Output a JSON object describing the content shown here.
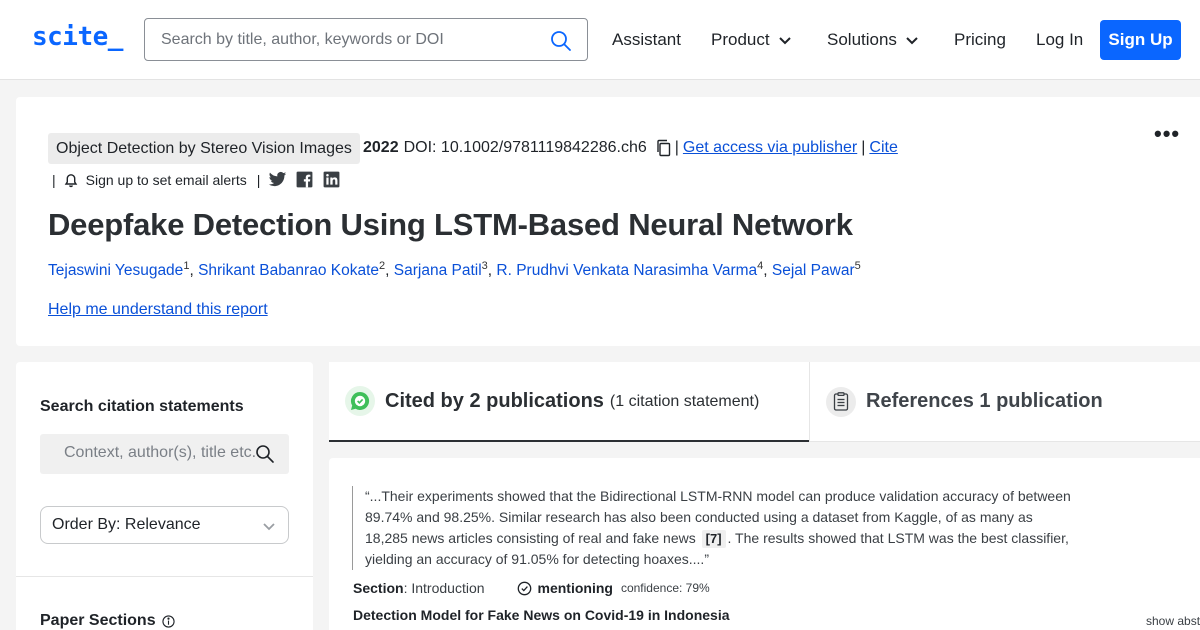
{
  "header": {
    "logo": "scite_",
    "search_placeholder": "Search by title, author, keywords or DOI",
    "nav": {
      "assistant": "Assistant",
      "product": "Product",
      "solutions": "Solutions",
      "pricing": "Pricing",
      "login": "Log In",
      "signup": "Sign Up"
    }
  },
  "paper": {
    "journal": "Object Detection by Stereo Vision Images",
    "year": "2022",
    "doi": "DOI: 10.1002/9781119842286.ch6",
    "get_access": "Get access via publisher",
    "cite": "Cite",
    "separator": "|",
    "email_alert": "Sign up to set email alerts",
    "more": "•••",
    "title": "Deepfake Detection Using LSTM-Based Neural Network",
    "authors": [
      {
        "name": "Tejaswini Yesugade",
        "sup": "1"
      },
      {
        "name": "Shrikant Babanrao Kokate",
        "sup": "2"
      },
      {
        "name": "Sarjana Patil",
        "sup": "3"
      },
      {
        "name": "R. Prudhvi Venkata Narasimha Varma",
        "sup": "4"
      },
      {
        "name": "Sejal Pawar",
        "sup": "5"
      }
    ],
    "help_link": "Help me understand this report"
  },
  "sidebar": {
    "heading": "Search citation statements",
    "search_placeholder": "Context, author(s), title etc.",
    "order_by": "Order By: Relevance",
    "paper_sections": "Paper Sections"
  },
  "tabs": {
    "cited_label": "Cited by 2 publications",
    "cited_sub": "(1 citation statement)",
    "refs_label": "References 1 publication"
  },
  "citation": {
    "quote_part1": "“...Their experiments showed that the Bidirectional LSTM-RNN model can produce validation accuracy of between 89.74% and 98.25%. Similar research has also been conducted using a dataset from Kaggle, of as many as 18,285 news articles consisting of real and fake news",
    "ref_tag": "[7]",
    "quote_part2": ". The results showed that LSTM was the best classifier, yielding an accuracy of 91.05% for detecting hoaxes....”",
    "section_label": "Section",
    "section_value": ": Introduction",
    "mention": "mentioning",
    "confidence": "confidence: 79%",
    "paper_title": "Detection Model for Fake News on Covid-19 in Indonesia",
    "show_abstract": "show abst"
  },
  "colors": {
    "brand": "#0a66ff",
    "link": "#0a50d8",
    "mention_green": "#3fbf5a"
  }
}
